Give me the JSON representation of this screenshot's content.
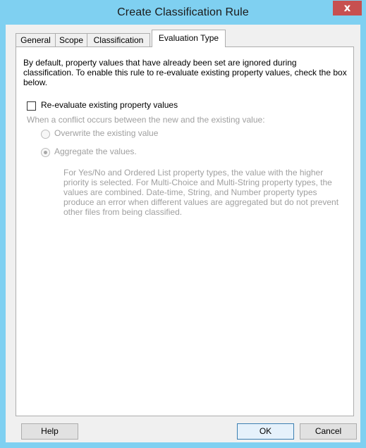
{
  "window": {
    "title": "Create Classification Rule",
    "close_label": "x"
  },
  "tabs": [
    {
      "label": "General"
    },
    {
      "label": "Scope"
    },
    {
      "label": "Classification"
    },
    {
      "label": "Evaluation Type",
      "active": true
    }
  ],
  "evaluation": {
    "intro": "By default, property values that have already been set are ignored during classification. To enable this rule to re-evaluate existing property values, check the box below.",
    "reevaluate_checkbox": {
      "label": "Re-evaluate existing property values",
      "checked": false
    },
    "conflict_label": "When a conflict occurs between the new and the existing value:",
    "options": [
      {
        "label": "Overwrite the existing value",
        "selected": false,
        "enabled": false
      },
      {
        "label": "Aggregate the values.",
        "selected": true,
        "enabled": false
      }
    ],
    "aggregate_help": "For Yes/No and Ordered List property types, the value with the higher priority is selected. For Multi-Choice and Multi-String property types, the values are combined. Date-time, String, and Number property types produce an error when different values are aggregated but do not prevent other files from being classified."
  },
  "buttons": {
    "help": "Help",
    "ok": "OK",
    "cancel": "Cancel"
  },
  "colors": {
    "titlebar": "#7fd0f1",
    "close_button": "#c75050",
    "disabled_text": "#a0a0a0"
  }
}
